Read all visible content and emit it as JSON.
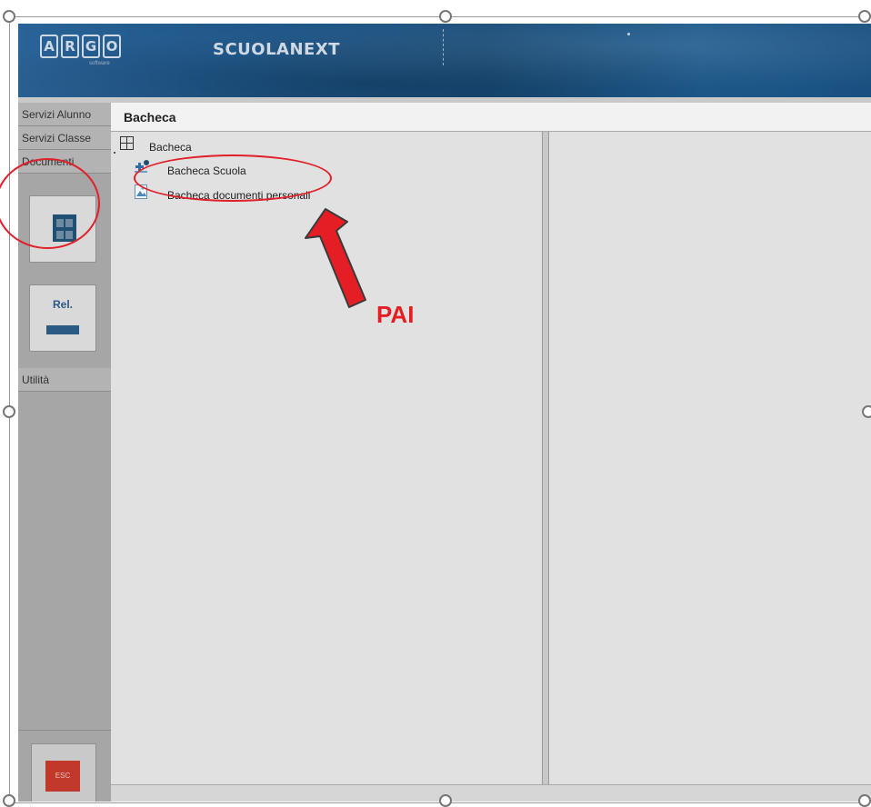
{
  "header": {
    "logo_letters": [
      "A",
      "R",
      "G",
      "O"
    ],
    "logo_subtitle": "software",
    "brand": "SCUOLANEXT"
  },
  "sidebar": {
    "tabs": [
      "Servizi Alunno",
      "Servizi Classe",
      "Documenti",
      "Utilità"
    ],
    "buttons": {
      "rel_label": "Rel.",
      "bottom_label": "ESC"
    }
  },
  "main": {
    "title": "Bacheca",
    "tree": {
      "root": "Bacheca",
      "items": [
        "Bacheca Scuola",
        "Bacheca documenti personali"
      ]
    }
  },
  "annotation": {
    "label": "PAI",
    "color": "#e41e24"
  },
  "colors": {
    "header_blue": "#1c5486",
    "sidebar_gray": "#a6a6a6",
    "panel_gray": "#e1e1e1",
    "annotation_red": "#e41e24"
  }
}
